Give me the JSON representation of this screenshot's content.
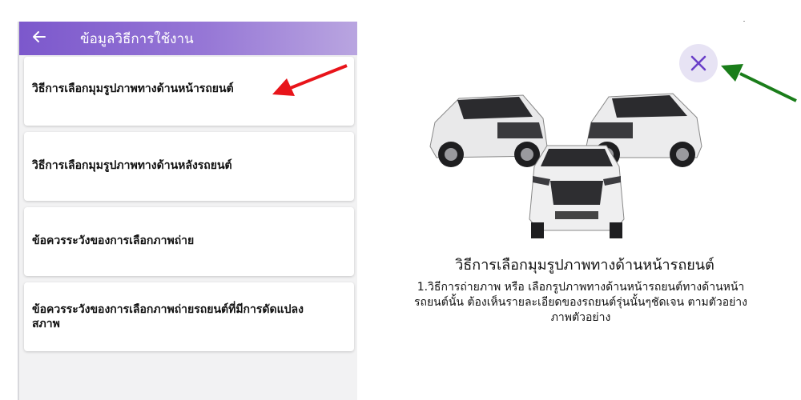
{
  "appbar": {
    "back_icon": "arrow-left-icon",
    "title": "ข้อมูลวิธีการใช้งาน"
  },
  "menu": {
    "items": [
      {
        "label": "วิธีการเลือกมุมรูปภาพทางด้านหน้ารถยนต์"
      },
      {
        "label": "วิธีการเลือกมุมรูปภาพทางด้านหลังรถยนต์"
      },
      {
        "label": "ข้อควรระวังของการเลือกภาพถ่าย"
      },
      {
        "label": " ข้อควรระวังของการเลือกภาพถ่ายรถยนต์ที่มีการดัดแปลงสภาพ"
      }
    ]
  },
  "detail": {
    "close_icon": "close-icon",
    "image_icon": "car-image",
    "title": "วิธีการเลือกมุมรูปภาพทางด้านหน้ารถยนต์",
    "body": "1.วิธีการถ่ายภาพ หรือ เลือกรูปภาพทางด้านหน้ารถยนต์ทางด้านหน้ารถยนต์นั้น ต้องเห็นรายละเอียดของรถยนต์รุ่นนั้นๆชัดเจน ตามตัวอย่างภาพตัวอย่าง"
  },
  "colors": {
    "appbar_start": "#7c58cc",
    "appbar_end": "#b9a5e0",
    "close_bg": "#e7e3f4",
    "close_x": "#6a3fc8",
    "red_arrow": "#e8141a",
    "green_arrow": "#1a7d1a"
  }
}
